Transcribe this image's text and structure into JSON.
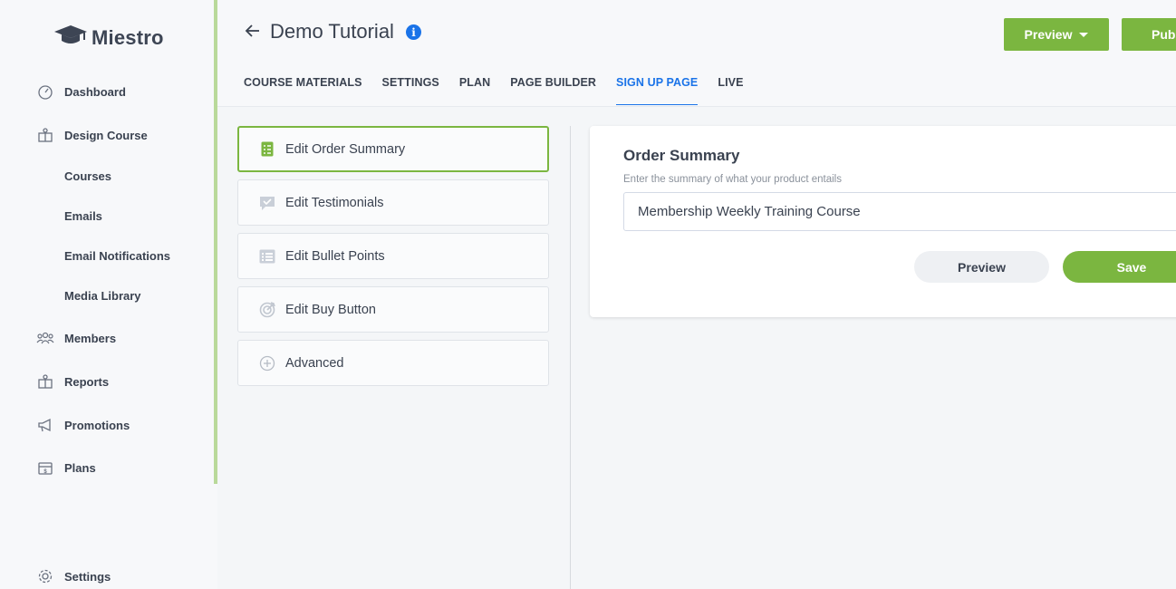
{
  "app": {
    "name": "Miestro"
  },
  "sidebar": {
    "items": [
      {
        "label": "Dashboard",
        "icon": "gauge-icon"
      },
      {
        "label": "Design Course",
        "icon": "book-icon"
      },
      {
        "label": "Courses"
      },
      {
        "label": "Emails"
      },
      {
        "label": "Email Notifications"
      },
      {
        "label": "Media Library"
      },
      {
        "label": "Members",
        "icon": "users-icon"
      },
      {
        "label": "Reports",
        "icon": "report-icon"
      },
      {
        "label": "Promotions",
        "icon": "megaphone-icon"
      },
      {
        "label": "Plans",
        "icon": "plans-icon"
      },
      {
        "label": "Settings",
        "icon": "gear-icon"
      }
    ]
  },
  "header": {
    "title": "Demo Tutorial",
    "preview_label": "Preview",
    "publish_label": "Publish",
    "tabs": [
      {
        "label": "COURSE MATERIALS"
      },
      {
        "label": "SETTINGS"
      },
      {
        "label": "PLAN"
      },
      {
        "label": "PAGE BUILDER"
      },
      {
        "label": "SIGN UP PAGE",
        "active": true
      },
      {
        "label": "LIVE"
      }
    ]
  },
  "edit_panel": {
    "items": [
      {
        "label": "Edit Order Summary",
        "icon": "checklist-icon",
        "active": true
      },
      {
        "label": "Edit Testimonials",
        "icon": "chat-check-icon"
      },
      {
        "label": "Edit Bullet Points",
        "icon": "list-icon"
      },
      {
        "label": "Edit Buy Button",
        "icon": "target-icon"
      },
      {
        "label": "Advanced",
        "icon": "plus-circle-icon"
      }
    ]
  },
  "order_summary": {
    "title": "Order Summary",
    "help": "Enter the summary of what your product entails",
    "value": "Membership Weekly Training Course",
    "preview_label": "Preview",
    "save_label": "Save"
  },
  "colors": {
    "accent": "#7bb640",
    "link": "#1a73e8",
    "text": "#3a4250"
  }
}
